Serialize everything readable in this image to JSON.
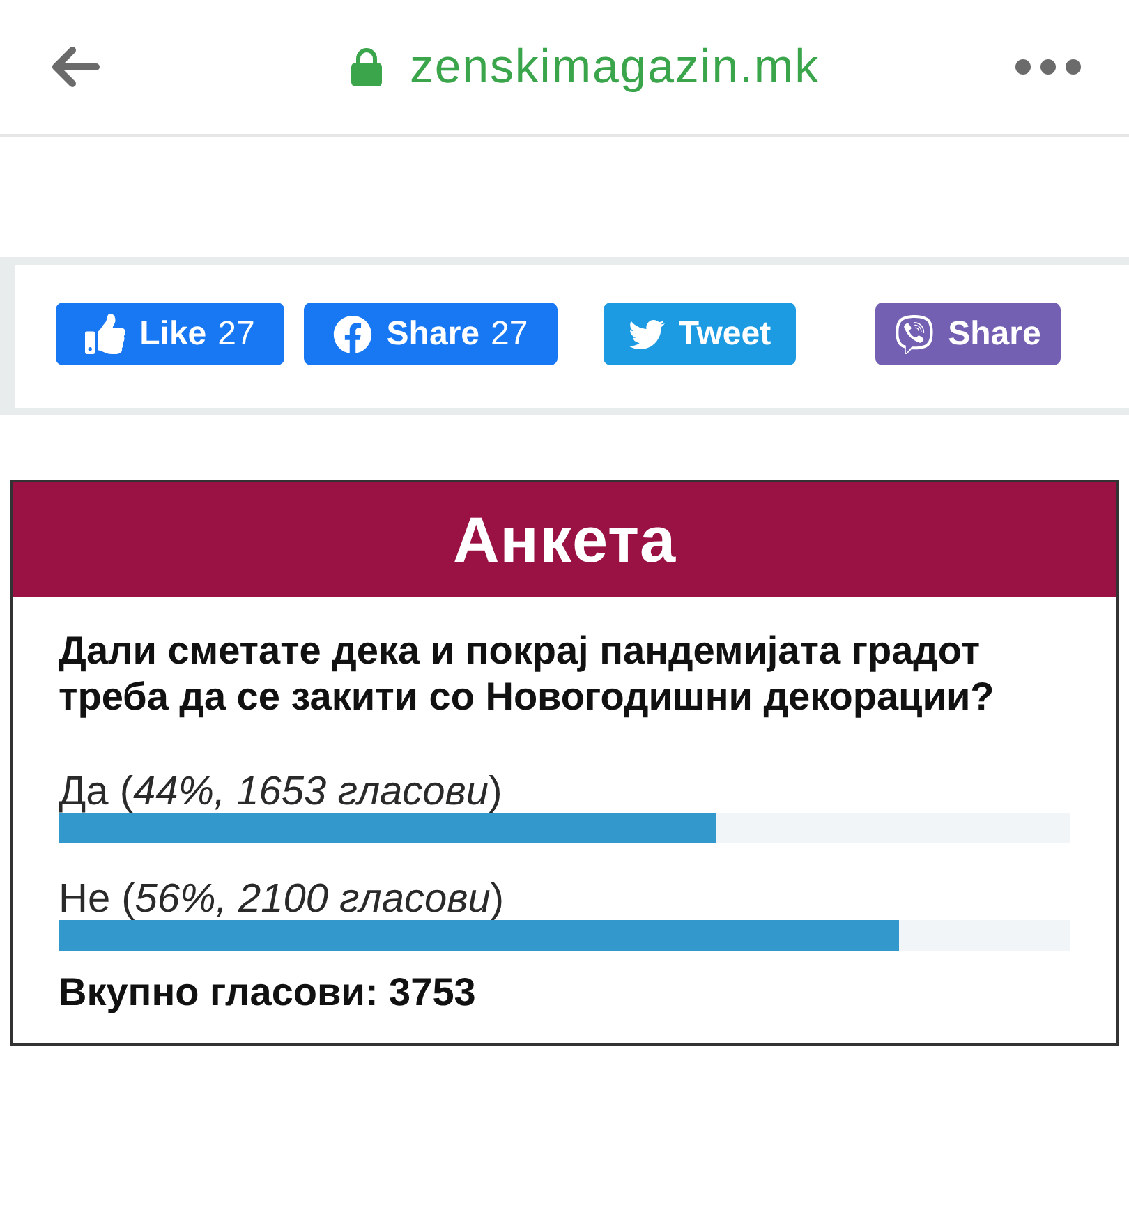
{
  "browser_bar": {
    "url": "zenskimagazin.mk",
    "secure": true
  },
  "share_buttons": [
    {
      "kind": "like",
      "label": "Like",
      "count": "27"
    },
    {
      "kind": "facebook",
      "label": "Share",
      "count": "27"
    },
    {
      "kind": "twitter",
      "label": "Tweet"
    },
    {
      "kind": "viber",
      "label": "Share"
    }
  ],
  "poll": {
    "title": "Анкета",
    "question": "Дали сметате дека и покрај пандемијата градот треба да се закити со Новогодишни декорации?",
    "options": [
      {
        "text": "Да (*44%, 1653 гласови*)",
        "level": 0.65
      },
      {
        "text": "Не (*56%, 2100 гласови*)",
        "level": 0.83
      }
    ],
    "total": "Вкупно гласови: 3753"
  }
}
